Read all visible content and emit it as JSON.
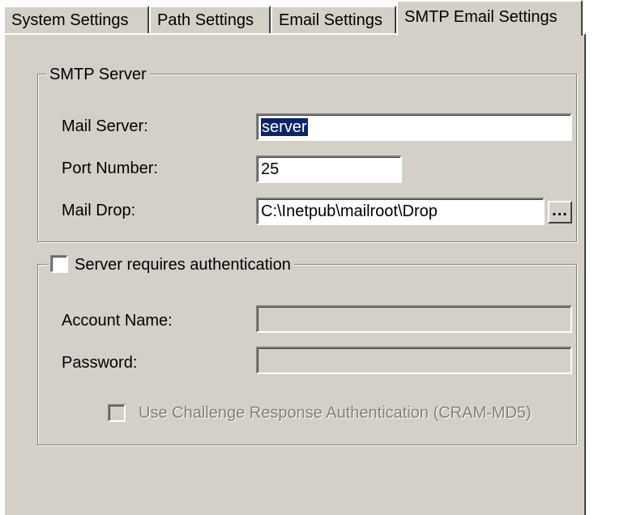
{
  "tabs": [
    {
      "label": "System Settings",
      "active": false
    },
    {
      "label": "Path Settings",
      "active": false
    },
    {
      "label": "Email Settings",
      "active": false
    },
    {
      "label": "SMTP Email Settings",
      "active": true
    }
  ],
  "smtp_server": {
    "title": "SMTP Server",
    "mail_server_label": "Mail Server:",
    "mail_server_value": "server",
    "port_label": "Port Number:",
    "port_value": "25",
    "mail_drop_label": "Mail Drop:",
    "mail_drop_value": "C:\\Inetpub\\mailroot\\Drop",
    "browse_label": "..."
  },
  "auth": {
    "checkbox_label": "Server requires authentication",
    "checked": false,
    "account_label": "Account Name:",
    "account_value": "",
    "password_label": "Password:",
    "password_value": "",
    "cram_label": "Use Challenge Response Authentication (CRAM-MD5)",
    "cram_checked": false,
    "cram_enabled": false
  },
  "colors": {
    "face": "#d4d0c8",
    "selection": "#0a246a",
    "disabled_text": "#808080"
  }
}
